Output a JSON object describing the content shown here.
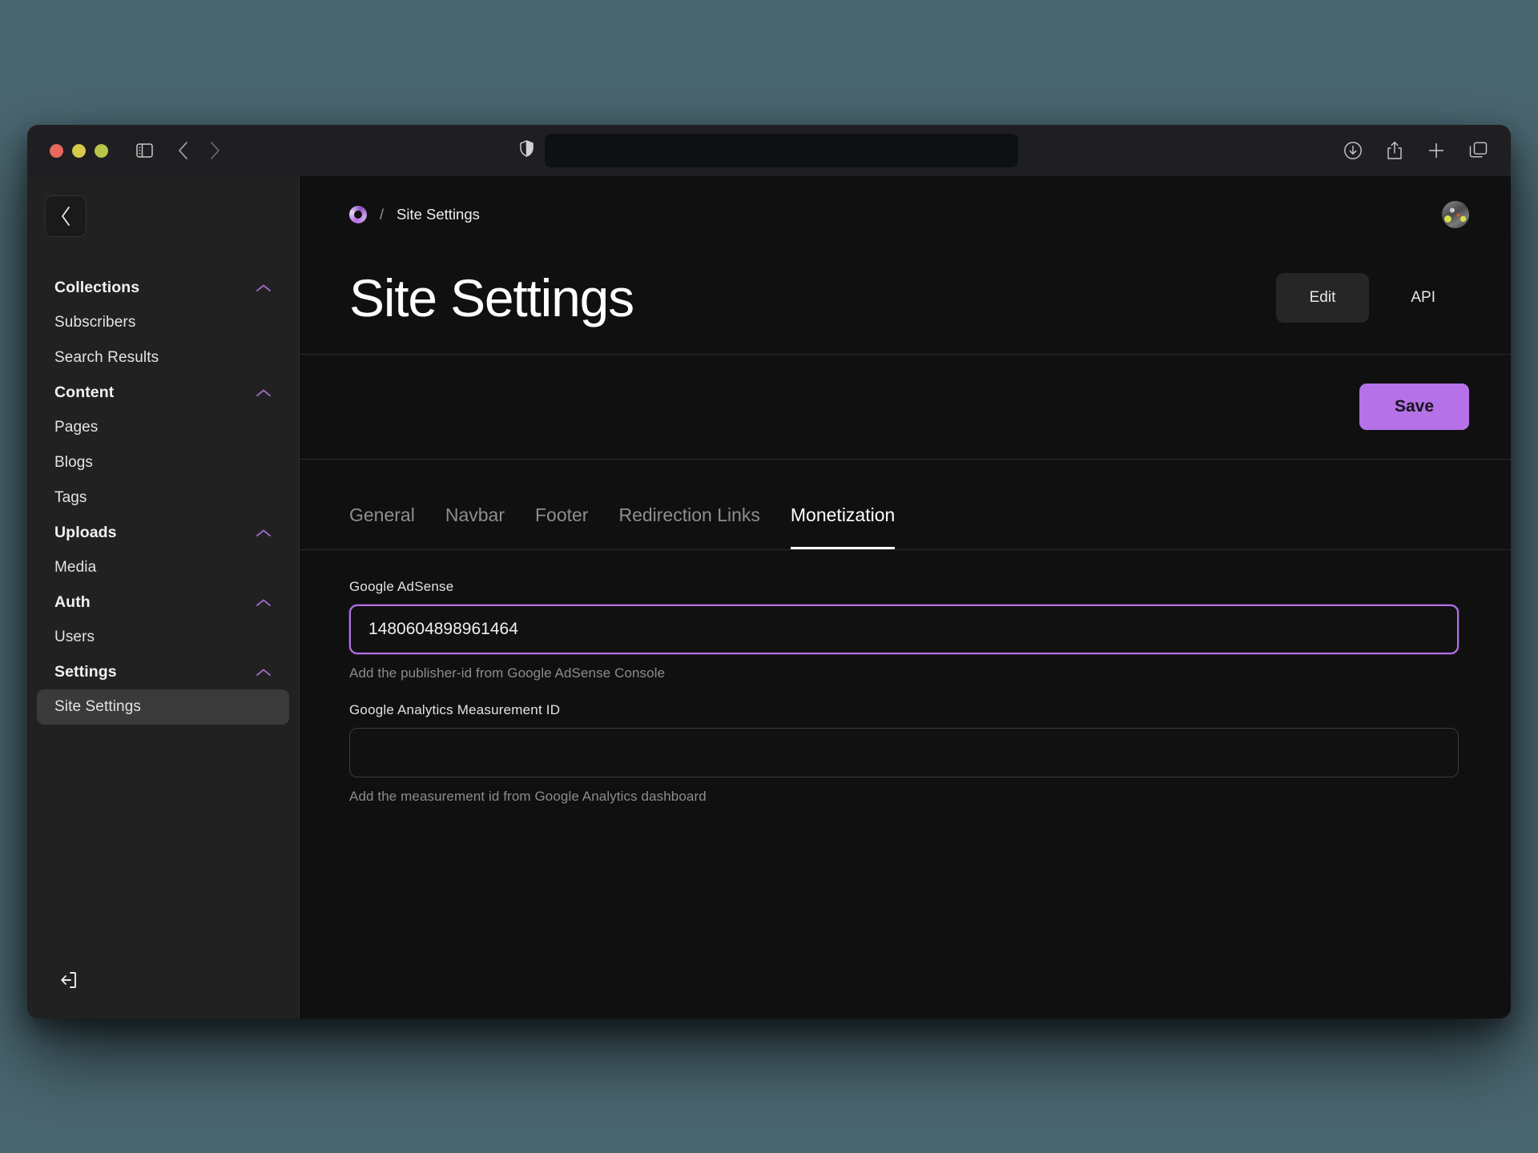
{
  "browser": {
    "traffic_lights": [
      "close",
      "minimize",
      "zoom"
    ],
    "sidebar_toggle_icon": "sidebar-icon",
    "back_icon": "chevron-left-icon",
    "forward_icon": "chevron-right-icon",
    "shield_icon": "shield-icon",
    "url_value": "",
    "url_placeholder": "",
    "reload_icon": "reload-icon",
    "downloads_icon": "download-icon",
    "share_icon": "share-icon",
    "new_tab_icon": "plus-icon",
    "tab_overview_icon": "tab-overview-icon"
  },
  "sidebar": {
    "back_icon": "chevron-left-icon",
    "collapse_icon": "chevron-up-icon",
    "logout_icon": "logout-icon",
    "groups": [
      {
        "label": "Collections",
        "items": [
          {
            "label": "Subscribers",
            "active": false
          },
          {
            "label": "Search Results",
            "active": false
          }
        ]
      },
      {
        "label": "Content",
        "items": [
          {
            "label": "Pages",
            "active": false
          },
          {
            "label": "Blogs",
            "active": false
          },
          {
            "label": "Tags",
            "active": false
          }
        ]
      },
      {
        "label": "Uploads",
        "items": [
          {
            "label": "Media",
            "active": false
          }
        ]
      },
      {
        "label": "Auth",
        "items": [
          {
            "label": "Users",
            "active": false
          }
        ]
      },
      {
        "label": "Settings",
        "items": [
          {
            "label": "Site Settings",
            "active": true
          }
        ]
      }
    ]
  },
  "header": {
    "logo_icon": "brand-ring-icon",
    "breadcrumb_separator": "/",
    "breadcrumb_current": "Site Settings",
    "avatar_icon": "user-avatar",
    "page_title": "Site Settings",
    "view_tabs": [
      {
        "label": "Edit",
        "active": true
      },
      {
        "label": "API",
        "active": false
      }
    ]
  },
  "actions": {
    "save_label": "Save",
    "save_color": "#b571e8"
  },
  "tabs": [
    {
      "label": "General",
      "active": false
    },
    {
      "label": "Navbar",
      "active": false
    },
    {
      "label": "Footer",
      "active": false
    },
    {
      "label": "Redirection Links",
      "active": false
    },
    {
      "label": "Monetization",
      "active": true
    }
  ],
  "form": {
    "fields": [
      {
        "label": "Google AdSense",
        "value": "1480604898961464",
        "placeholder": "",
        "help": "Add the publisher-id from Google AdSense Console",
        "focused": true
      },
      {
        "label": "Google Analytics Measurement ID",
        "value": "",
        "placeholder": "",
        "help": "Add the measurement id from Google Analytics dashboard",
        "focused": false
      }
    ]
  },
  "colors": {
    "accent": "#b571e8",
    "chevron": "#9a6bbf",
    "page_bg": "#101010",
    "sidebar_bg": "#212121",
    "desktop_bg": "#4a6670"
  }
}
